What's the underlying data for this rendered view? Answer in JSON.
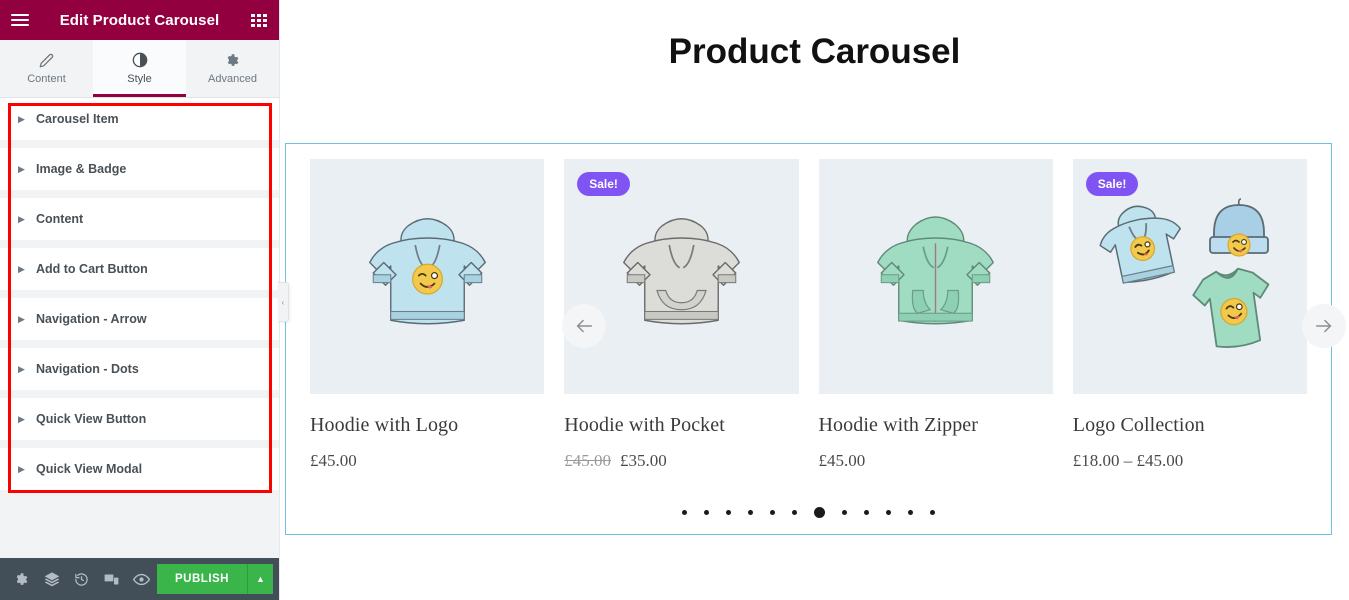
{
  "panel": {
    "header": {
      "title": "Edit Product Carousel",
      "menu_icon": "hamburger-menu-icon",
      "apps_icon": "apps-grid-icon"
    },
    "tabs": [
      {
        "label": "Content",
        "icon": "pencil-icon",
        "active": false
      },
      {
        "label": "Style",
        "icon": "contrast-circle-icon",
        "active": true
      },
      {
        "label": "Advanced",
        "icon": "gear-icon",
        "active": false
      }
    ],
    "sections": [
      {
        "label": "Carousel Item"
      },
      {
        "label": "Image & Badge"
      },
      {
        "label": "Content"
      },
      {
        "label": "Add to Cart Button"
      },
      {
        "label": "Navigation - Arrow"
      },
      {
        "label": "Navigation - Dots"
      },
      {
        "label": "Quick View Button"
      },
      {
        "label": "Quick View Modal"
      }
    ],
    "footer": {
      "icons": [
        {
          "name": "settings-gear-icon"
        },
        {
          "name": "navigator-layers-icon"
        },
        {
          "name": "history-icon"
        },
        {
          "name": "responsive-mode-icon"
        },
        {
          "name": "preview-eye-icon"
        }
      ],
      "publish_label": "PUBLISH",
      "publish_arrow": "▲",
      "publish_color": "#39b54a"
    },
    "collapse_handle": "‹",
    "highlight_color": "#ff0000",
    "header_color": "#93003f"
  },
  "preview": {
    "page_title": "Product Carousel",
    "selection_color": "#6ec1e4",
    "nav": {
      "prev": "←",
      "next": "→"
    },
    "dots": {
      "count": 12,
      "active_index": 6
    },
    "products": [
      {
        "name": "Hoodie with Logo",
        "price": "£45.00",
        "old_price": "",
        "badge": "",
        "image": "blue-hoodie-with-emoji-logo"
      },
      {
        "name": "Hoodie with Pocket",
        "price": "£35.00",
        "old_price": "£45.00",
        "badge": "Sale!",
        "image": "gray-hoodie-with-pocket"
      },
      {
        "name": "Hoodie with Zipper",
        "price": "£45.00",
        "old_price": "",
        "badge": "",
        "image": "mint-green-zip-hoodie"
      },
      {
        "name": "Logo Collection",
        "price": "£18.00 – £45.00",
        "old_price": "",
        "badge": "Sale!",
        "image": "logo-collection-hoodie-beanie-tshirt"
      }
    ],
    "badge_color": "#7f54f3"
  }
}
